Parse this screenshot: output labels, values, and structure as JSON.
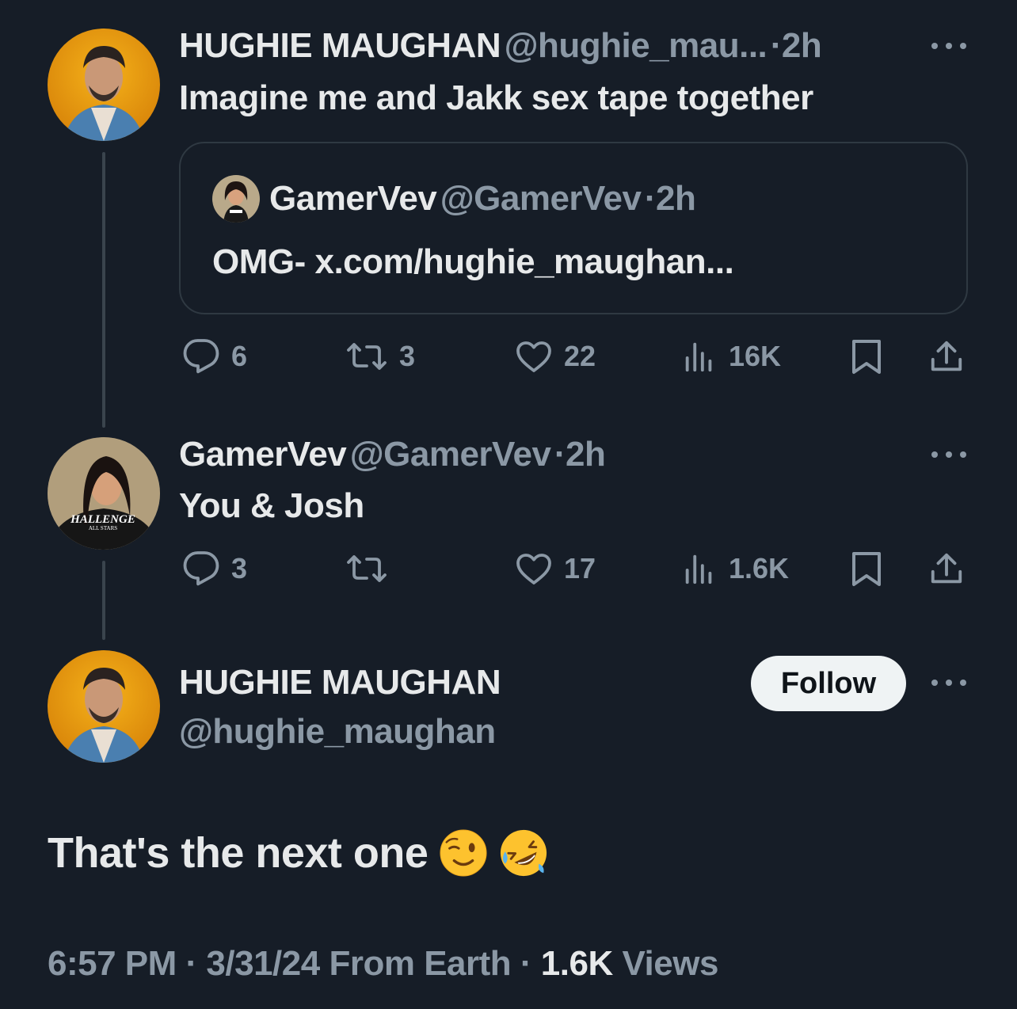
{
  "tweet1": {
    "name": "HUGHIE MAUGHAN",
    "handle": "@hughie_mau...",
    "sep": "·",
    "time": "2h",
    "text": "Imagine me and Jakk sex tape together",
    "quote": {
      "name": "GamerVev",
      "handle": "@GamerVev",
      "sep": "·",
      "time": "2h",
      "text": "OMG- x.com/hughie_maughan..."
    },
    "actions": {
      "replies": "6",
      "reposts": "3",
      "likes": "22",
      "views": "16K"
    }
  },
  "tweet2": {
    "name": "GamerVev",
    "handle": "@GamerVev",
    "sep": "·",
    "time": "2h",
    "text": "You & Josh",
    "shirt_text": "HALLENGE",
    "shirt_subtext": "ALL STARS",
    "actions": {
      "replies": "3",
      "reposts": "",
      "likes": "17",
      "views": "1.6K"
    }
  },
  "main_tweet": {
    "name": "HUGHIE MAUGHAN",
    "handle": "@hughie_maughan",
    "follow_label": "Follow",
    "text": "That's the next one",
    "emojis": [
      "winking-face-emoji",
      "rolling-laughing-emoji"
    ],
    "time": "6:57 PM",
    "sep": "·",
    "date": "3/31/24",
    "location": "From Earth",
    "views_count": "1.6K",
    "views_label": "Views"
  },
  "colors": {
    "background": "#161d27",
    "text": "#e7e9ea",
    "muted": "#8b98a5",
    "border": "#2f3942"
  }
}
